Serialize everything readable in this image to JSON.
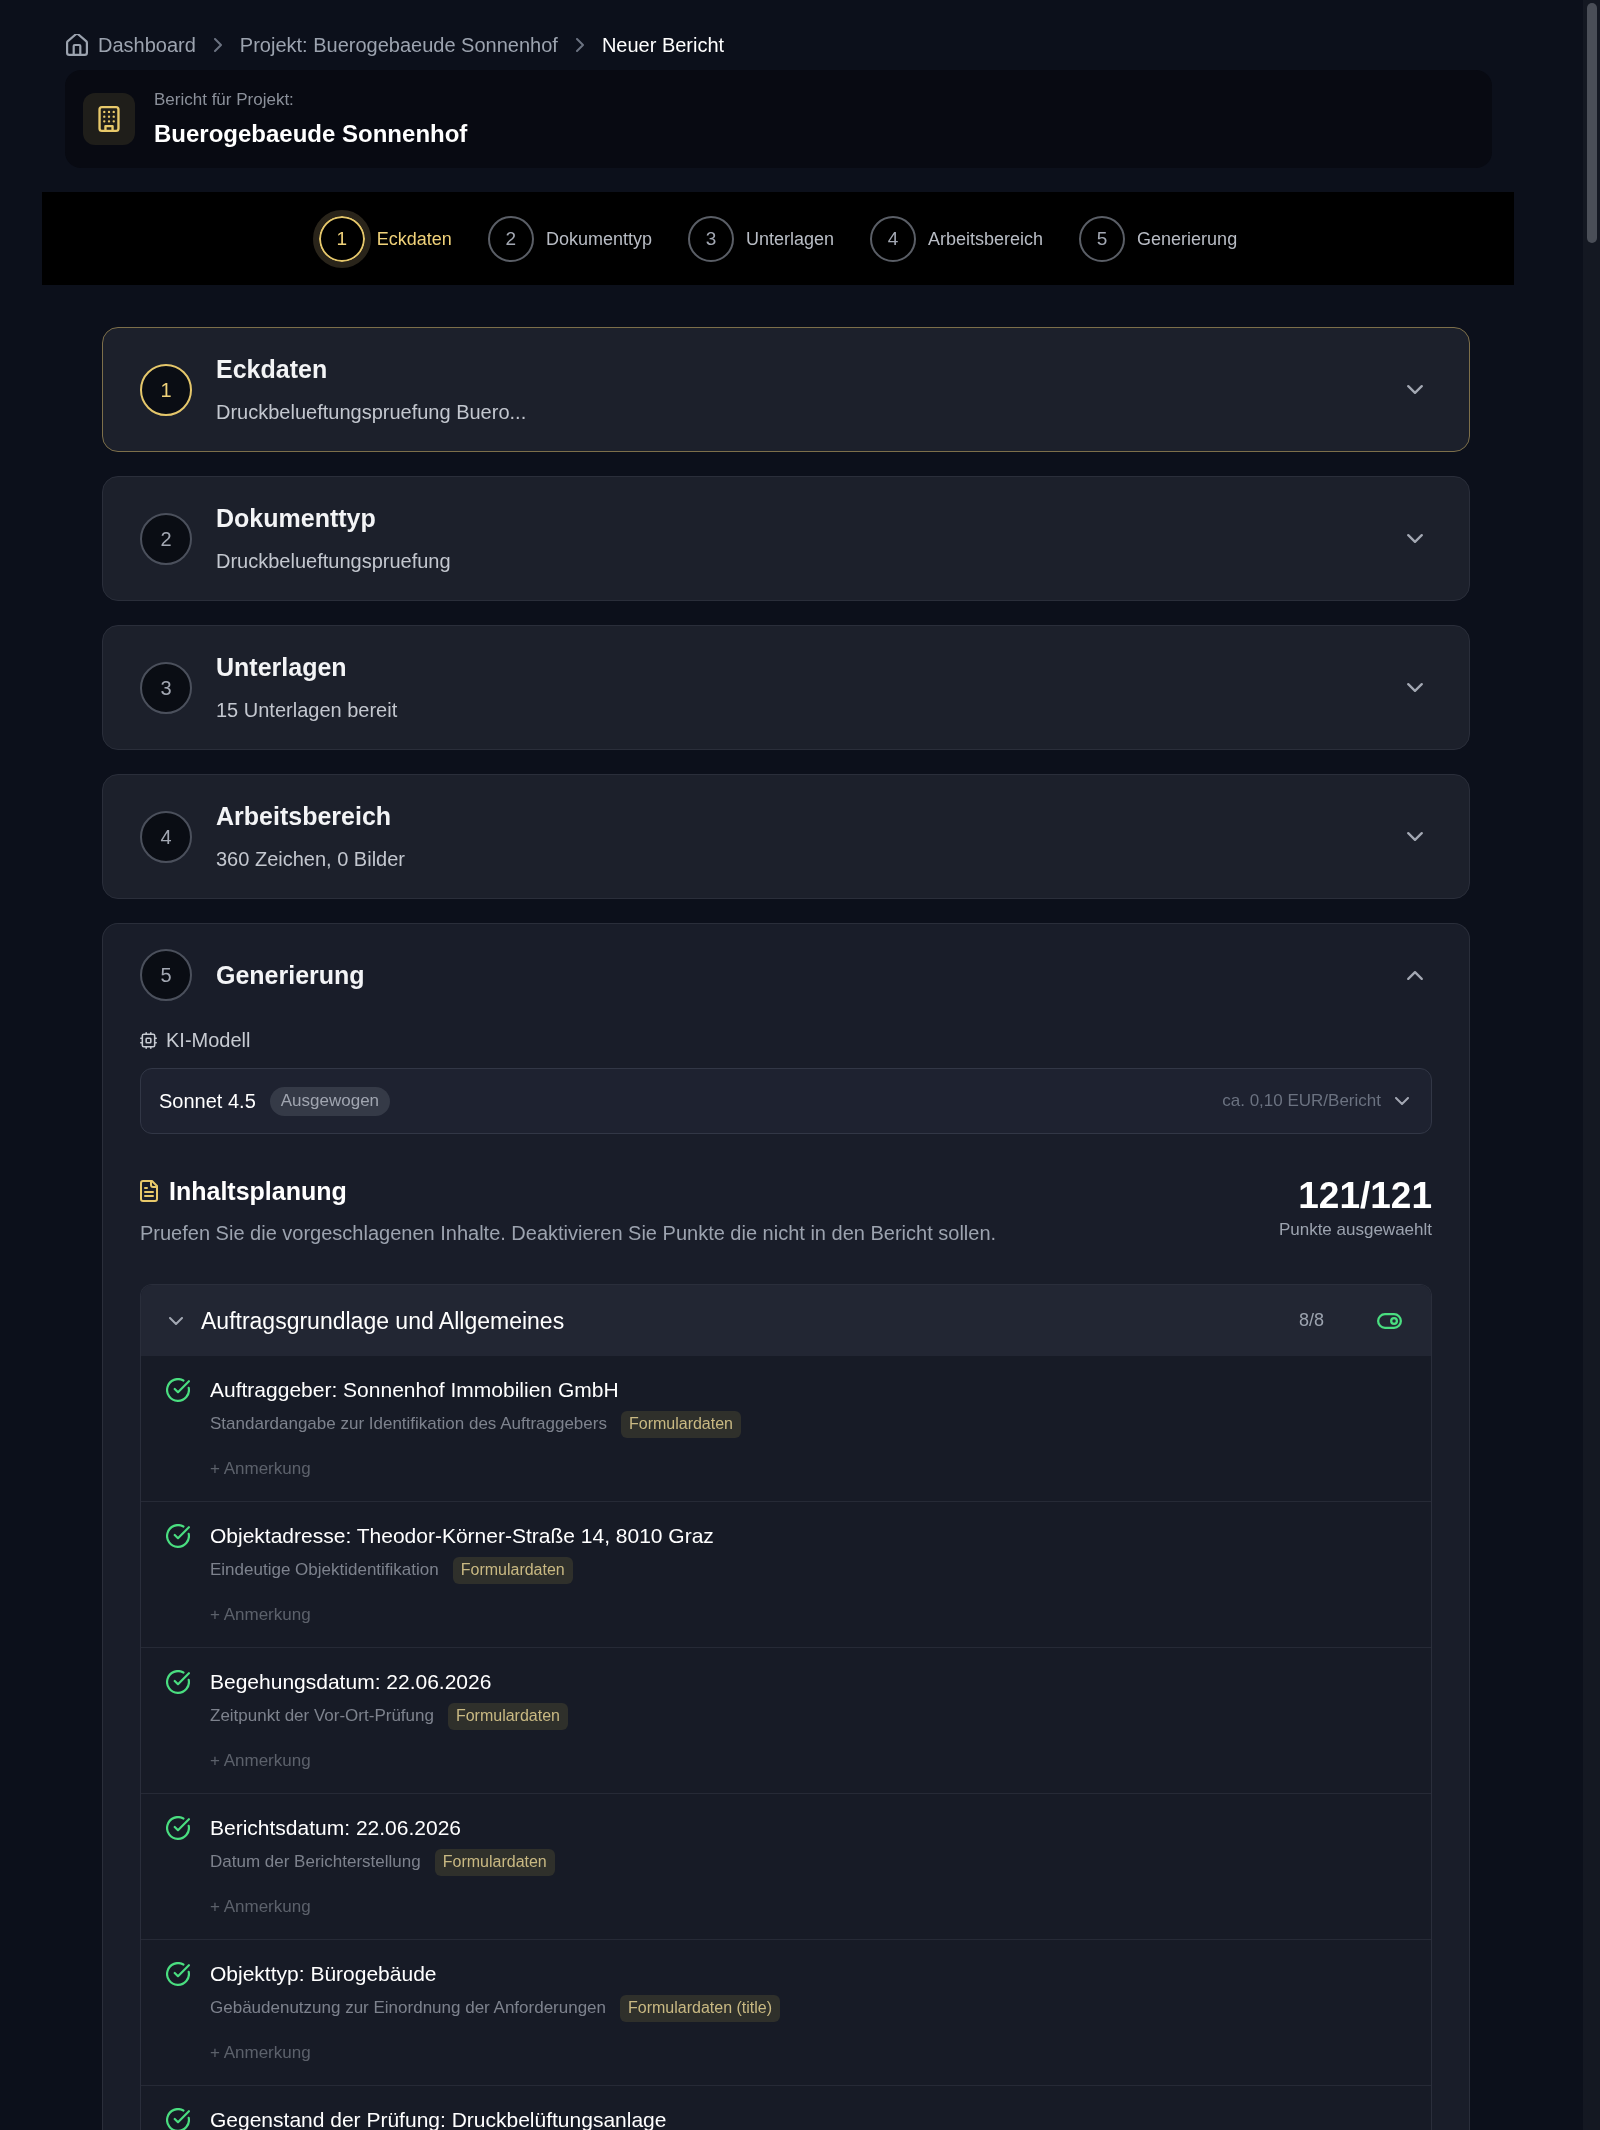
{
  "breadcrumb": [
    {
      "kind": "home",
      "label": "Dashboard"
    },
    {
      "kind": "link",
      "label": "Projekt: Buerogebaeude Sonnenhof"
    },
    {
      "kind": "current",
      "label": "Neuer Bericht"
    }
  ],
  "project": {
    "caption": "Bericht für Projekt:",
    "name": "Buerogebaeude Sonnenhof"
  },
  "stepper": [
    {
      "number": "1",
      "label": "Eckdaten",
      "selected": true
    },
    {
      "number": "2",
      "label": "Dokumenttyp",
      "selected": false
    },
    {
      "number": "3",
      "label": "Unterlagen",
      "selected": false
    },
    {
      "number": "4",
      "label": "Arbeitsbereich",
      "selected": false
    },
    {
      "number": "5",
      "label": "Generierung",
      "selected": false
    }
  ],
  "steps": [
    {
      "number": "1",
      "title": "Eckdaten",
      "summary": "Druckbelueftungspruefung Buero...",
      "selected": true,
      "expanded": false
    },
    {
      "number": "2",
      "title": "Dokumenttyp",
      "summary": "Druckbelueftungspruefung",
      "selected": false,
      "expanded": false
    },
    {
      "number": "3",
      "title": "Unterlagen",
      "summary": "15 Unterlagen bereit",
      "selected": false,
      "expanded": false
    },
    {
      "number": "4",
      "title": "Arbeitsbereich",
      "summary": "360 Zeichen, 0 Bilder",
      "selected": false,
      "expanded": false
    },
    {
      "number": "5",
      "title": "Generierung",
      "selected": false,
      "expanded": true,
      "model": {
        "label": "KI-Modell",
        "name": "Sonnet 4.5",
        "tag": "Ausgewogen",
        "price": "ca. 0,10 EUR/Bericht"
      },
      "planning": {
        "title": "Inhaltsplanung",
        "description": "Pruefen Sie die vorgeschlagenen Inhalte. Deaktivieren Sie Punkte die nicht in den Bericht sollen.",
        "count": "121/121",
        "count_label": "Punkte ausgewaehlt",
        "sections": [
          {
            "title": "Auftragsgrundlage und Allgemeines",
            "count": "8/8",
            "expanded": true,
            "on": true,
            "items": [
              {
                "title": "Auftraggeber: Sonnenhof Immobilien GmbH",
                "description": "Standardangabe zur Identifikation des Auftraggebers",
                "source": "Formulardaten",
                "note": "+ Anmerkung",
                "checked": true
              },
              {
                "title": "Objektadresse: Theodor-Körner-Straße 14, 8010 Graz",
                "description": "Eindeutige Objektidentifikation",
                "source": "Formulardaten",
                "note": "+ Anmerkung",
                "checked": true
              },
              {
                "title": "Begehungsdatum: 22.06.2026",
                "description": "Zeitpunkt der Vor-Ort-Prüfung",
                "source": "Formulardaten",
                "note": "+ Anmerkung",
                "checked": true
              },
              {
                "title": "Berichtsdatum: 22.06.2026",
                "description": "Datum der Berichterstellung",
                "source": "Formulardaten",
                "note": "+ Anmerkung",
                "checked": true
              },
              {
                "title": "Objekttyp: Bürogebäude",
                "description": "Gebäudenutzung zur Einordnung der Anforderungen",
                "source": "Formulardaten (title)",
                "note": "+ Anmerkung",
                "checked": true
              },
              {
                "title": "Gegenstand der Prüfung: Druckbelüftungsanlage",
                "checked": true
              }
            ]
          }
        ]
      }
    }
  ]
}
